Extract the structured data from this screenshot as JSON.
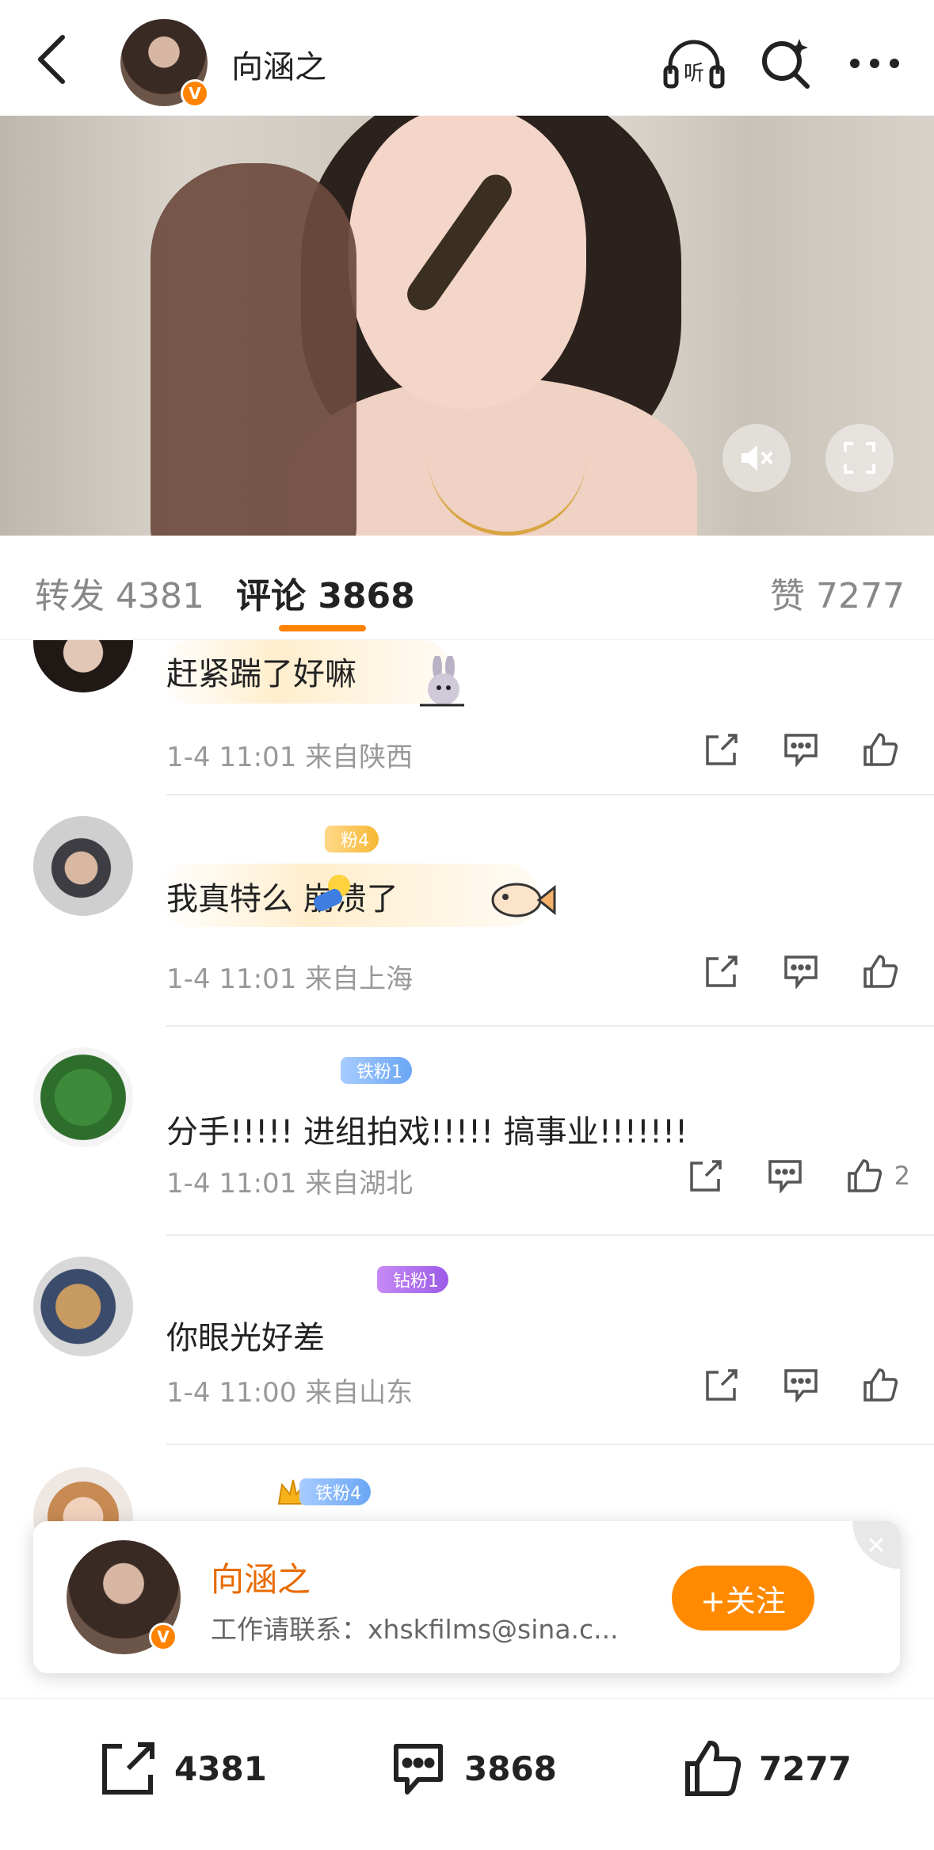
{
  "header": {
    "username": "向涵之",
    "verified_badge": "V"
  },
  "tabs": [
    {
      "label": "转发",
      "count": "4381"
    },
    {
      "label": "评论",
      "count": "3868"
    },
    {
      "label": "赞",
      "count": "7277"
    }
  ],
  "comments": [
    {
      "badge": "",
      "text": "赶紧踹了好嘛",
      "time": "1-4 11:01",
      "location": "来自陕西",
      "likes": ""
    },
    {
      "badge": "粉4",
      "text": "我真特么  崩溃了",
      "time": "1-4 11:01",
      "location": "来自上海",
      "likes": ""
    },
    {
      "badge": "铁粉1",
      "text": "分手!!!!! 进组拍戏!!!!! 搞事业!!!!!!!",
      "time": "1-4 11:01",
      "location": "来自湖北",
      "likes": "2"
    },
    {
      "badge": "钻粉1",
      "text": "你眼光好差",
      "time": "1-4 11:00",
      "location": "来自山东",
      "likes": ""
    },
    {
      "badge": "铁粉4",
      "text": "",
      "time": "",
      "location": "",
      "likes": ""
    }
  ],
  "follow_card": {
    "name": "向涵之",
    "description": "工作请联系：xhskfilms@sina.c...",
    "follow_label": "+关注"
  },
  "bottom_bar": {
    "repost_count": "4381",
    "comment_count": "3868",
    "like_count": "7277"
  },
  "colors": {
    "accent": "#ff8200",
    "muted": "#999999"
  }
}
